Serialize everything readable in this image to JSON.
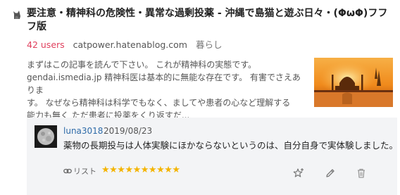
{
  "entry": {
    "title": "要注意・精神科の危険性・異常な過剰投薬 - 沖縄で島猫と遊ぶ日々・(ΦωΦ)フフフ版",
    "users": "42 users",
    "domain": "catpower.hatenablog.com",
    "category": "暮らし",
    "excerpt": "まずはこの記事を読んで下さい。 これが精神科の実態です。\ngendai.ismedia.jp 精神科医は基本的に無能な存在です。 有害でさえありま\nす。 なぜなら精神科は科学でもなく、ましてや患者の心など理解する\n能力も無く ただ患者に投薬をくり返すだ..."
  },
  "comment": {
    "user": "luna3018",
    "date": "2019/08/23",
    "text": "薬物の長期投与は人体実験にほかならないというのは、自分自身で実体験しました。",
    "list_label": "リスト",
    "stars": "★★★★★★★★★★"
  },
  "icons": {
    "favicon": "cat-favicon-icon",
    "list": "link-icon",
    "star": "star-add-icon",
    "edit": "pencil-icon",
    "delete": "trash-icon"
  },
  "colors": {
    "users": "#e0415e",
    "username": "#2e6ba8",
    "stars": "#f4b400",
    "comment_bg": "#f3f4f6"
  }
}
